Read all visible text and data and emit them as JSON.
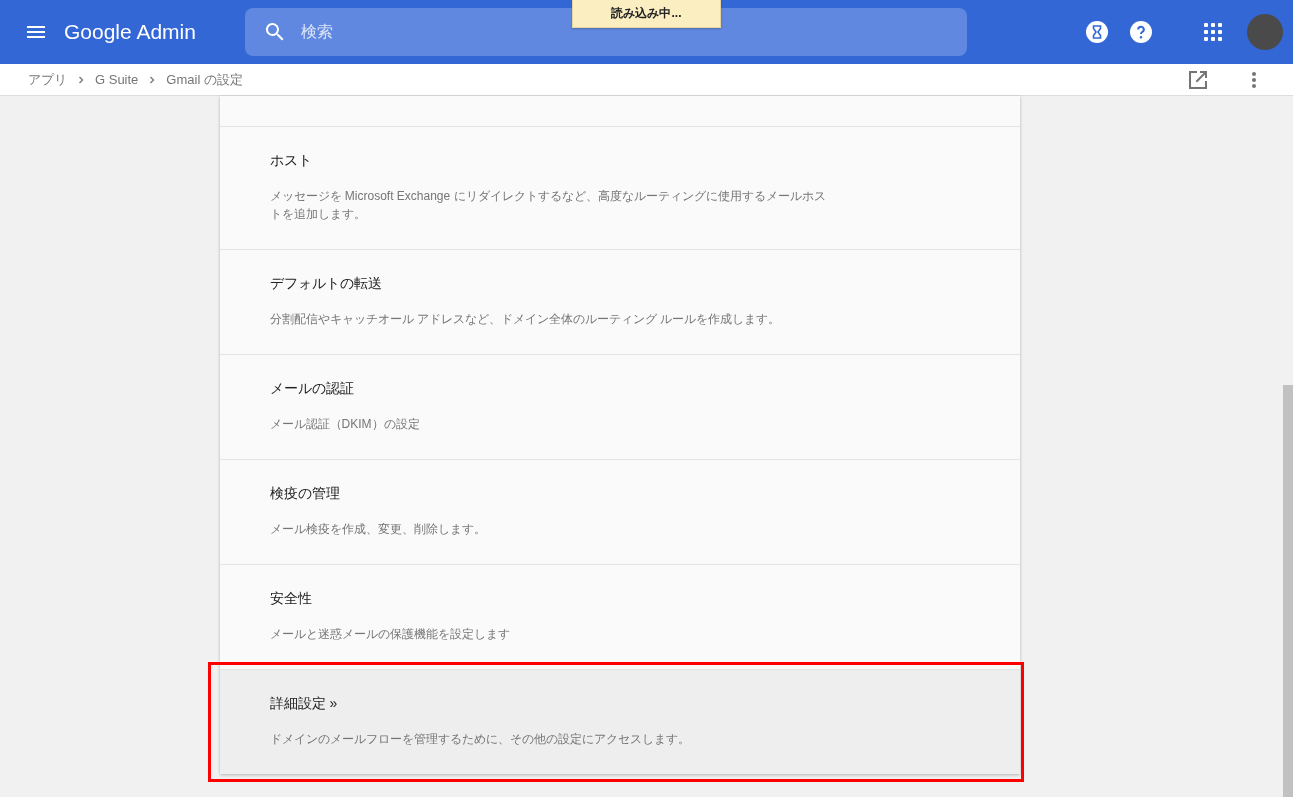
{
  "header": {
    "product": "Google Admin",
    "search": {
      "placeholder": "検索"
    },
    "loading_toast": "読み込み中..."
  },
  "breadcrumb": [
    {
      "label": "アプリ"
    },
    {
      "label": "G Suite"
    },
    {
      "label": "Gmail の設定"
    }
  ],
  "settings": [
    {
      "title": "ホスト",
      "description": "メッセージを Microsoft Exchange にリダイレクトするなど、高度なルーティングに使用するメールホストを追加します。",
      "highlighted": false,
      "annotated": false
    },
    {
      "title": "デフォルトの転送",
      "description": "分割配信やキャッチオール アドレスなど、ドメイン全体のルーティング ルールを作成します。",
      "highlighted": false,
      "annotated": false
    },
    {
      "title": "メールの認証",
      "description": "メール認証（DKIM）の設定",
      "highlighted": false,
      "annotated": false
    },
    {
      "title": "検疫の管理",
      "description": "メール検疫を作成、変更、削除します。",
      "highlighted": false,
      "annotated": false
    },
    {
      "title": "安全性",
      "description": "メールと迷惑メールの保護機能を設定します",
      "highlighted": false,
      "annotated": false
    },
    {
      "title": "詳細設定 »",
      "description": "ドメインのメールフローを管理するために、その他の設定にアクセスします。",
      "highlighted": true,
      "annotated": true
    }
  ]
}
